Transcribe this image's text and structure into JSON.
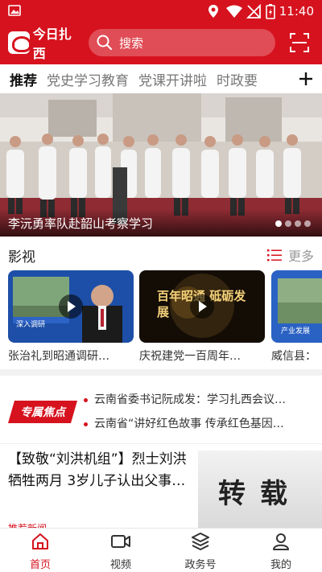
{
  "status_bar": {
    "time": "11:40"
  },
  "header": {
    "app_name": "今日扎西",
    "search_placeholder": "搜索"
  },
  "tabs": [
    {
      "label": "推荐",
      "active": true
    },
    {
      "label": "党史学习教育"
    },
    {
      "label": "党课开讲啦"
    },
    {
      "label": "时政要"
    }
  ],
  "banner": {
    "caption": "李沅勇率队赴韶山考察学习",
    "dots": 4,
    "active_dot": 0
  },
  "video_section": {
    "title": "影视",
    "more_label": "更多",
    "items": [
      {
        "title": "张治礼到昭通调研…",
        "thumb_label": "深入调研"
      },
      {
        "title": "庆祝建党一百周年…",
        "thumb_label": "百年昭通 砥砺发展"
      },
      {
        "title": "威信县：",
        "thumb_label": "产业发展"
      }
    ]
  },
  "focus": {
    "badge": "专属焦点",
    "items": [
      "云南省委书记阮成发：学习扎西会议…",
      "云南省“讲好红色故事 传承红色基因…"
    ]
  },
  "article": {
    "title": "【致敬“刘洪机组”】烈士刘洪牺牲两月 3岁儿子认出父事…",
    "image_text": "转载",
    "meta": "推荐新闻"
  },
  "bottom_nav": [
    {
      "label": "首页",
      "icon": "home-icon",
      "active": true
    },
    {
      "label": "视频",
      "icon": "video-icon"
    },
    {
      "label": "政务号",
      "icon": "layers-icon"
    },
    {
      "label": "我的",
      "icon": "user-icon"
    }
  ],
  "colors": {
    "brand": "#d6121e",
    "text": "#222222",
    "muted": "#999999"
  }
}
